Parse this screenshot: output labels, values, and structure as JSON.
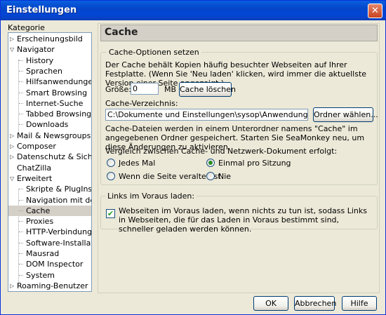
{
  "window": {
    "title": "Einstellungen",
    "close_glyph": "✕"
  },
  "sidebar": {
    "label": "Kategorie",
    "items": [
      {
        "label": "Erscheinungsbild",
        "level": 0,
        "expander": "collapsed"
      },
      {
        "label": "Navigator",
        "level": 0,
        "expander": "expanded"
      },
      {
        "label": "History",
        "level": 1
      },
      {
        "label": "Sprachen",
        "level": 1
      },
      {
        "label": "Hilfsanwendungen",
        "level": 1
      },
      {
        "label": "Smart Browsing",
        "level": 1
      },
      {
        "label": "Internet-Suche",
        "level": 1
      },
      {
        "label": "Tabbed Browsing",
        "level": 1
      },
      {
        "label": "Downloads",
        "level": 1
      },
      {
        "label": "Mail & Newsgroups",
        "level": 0,
        "expander": "collapsed"
      },
      {
        "label": "Composer",
        "level": 0,
        "expander": "collapsed"
      },
      {
        "label": "Datenschutz & Sicherheit",
        "level": 0,
        "expander": "collapsed"
      },
      {
        "label": "ChatZilla",
        "level": 0
      },
      {
        "label": "Erweitert",
        "level": 0,
        "expander": "expanded"
      },
      {
        "label": "Skripte & PlugIns",
        "level": 1
      },
      {
        "label": "Navigation mit der ...",
        "level": 1
      },
      {
        "label": "Cache",
        "level": 1,
        "selected": true
      },
      {
        "label": "Proxies",
        "level": 1
      },
      {
        "label": "HTTP-Verbindungen",
        "level": 1
      },
      {
        "label": "Software-Installation",
        "level": 1
      },
      {
        "label": "Mausrad",
        "level": 1
      },
      {
        "label": "DOM Inspector",
        "level": 1
      },
      {
        "label": "System",
        "level": 1
      },
      {
        "label": "Roaming-Benutzer",
        "level": 0,
        "expander": "collapsed"
      }
    ]
  },
  "panel": {
    "title": "Cache",
    "cache_options": {
      "legend": "Cache-Optionen setzen",
      "description": "Der Cache behält Kopien häufig besuchter Webseiten auf Ihrer Festplatte. (Wenn Sie 'Neu laden' klicken, wird immer die aktuellste Version einer Seite angezeigt.)",
      "size_label": "Größe:",
      "size_value": "0",
      "size_unit": "MB",
      "clear_button": "Cache löschen",
      "dir_label": "Cache-Verzeichnis:",
      "dir_value": "C:\\Dokumente und Einstellungen\\sysop\\Anwendungsdaten\\Mozilla\\Pro",
      "choose_button": "Ordner wählen...",
      "dir_note": "Cache-Dateien werden in einem Unterordner namens \"Cache\" im angegebenen Ordner gespeichert. Starten Sie SeaMonkey neu, um diese Änderungen zu aktivieren.",
      "compare_label": "Vergleich zwischen Cache- und Netzwerk-Dokument erfolgt:",
      "radio_every_time": "Jedes Mal",
      "radio_once_per_session": "Einmal pro Sitzung",
      "radio_when_outdated": "Wenn die Seite veraltet ist",
      "radio_never": "Nie",
      "selected_option": "Einmal pro Sitzung"
    },
    "prefetch": {
      "legend": "Links im Voraus laden:",
      "checkbox_label": "Webseiten im Voraus laden, wenn nichts zu tun ist, sodass Links in Webseiten, die für das Laden in Voraus bestimmt sind, schneller geladen werden können.",
      "checked": true,
      "check_glyph": "✔"
    }
  },
  "footer": {
    "ok": "OK",
    "cancel": "Abbrechen",
    "help": "Hilfe"
  },
  "colors": {
    "titlebar": "#0246d6",
    "selection": "#d4d0c8",
    "dialog_bg": "#ece9d8"
  }
}
